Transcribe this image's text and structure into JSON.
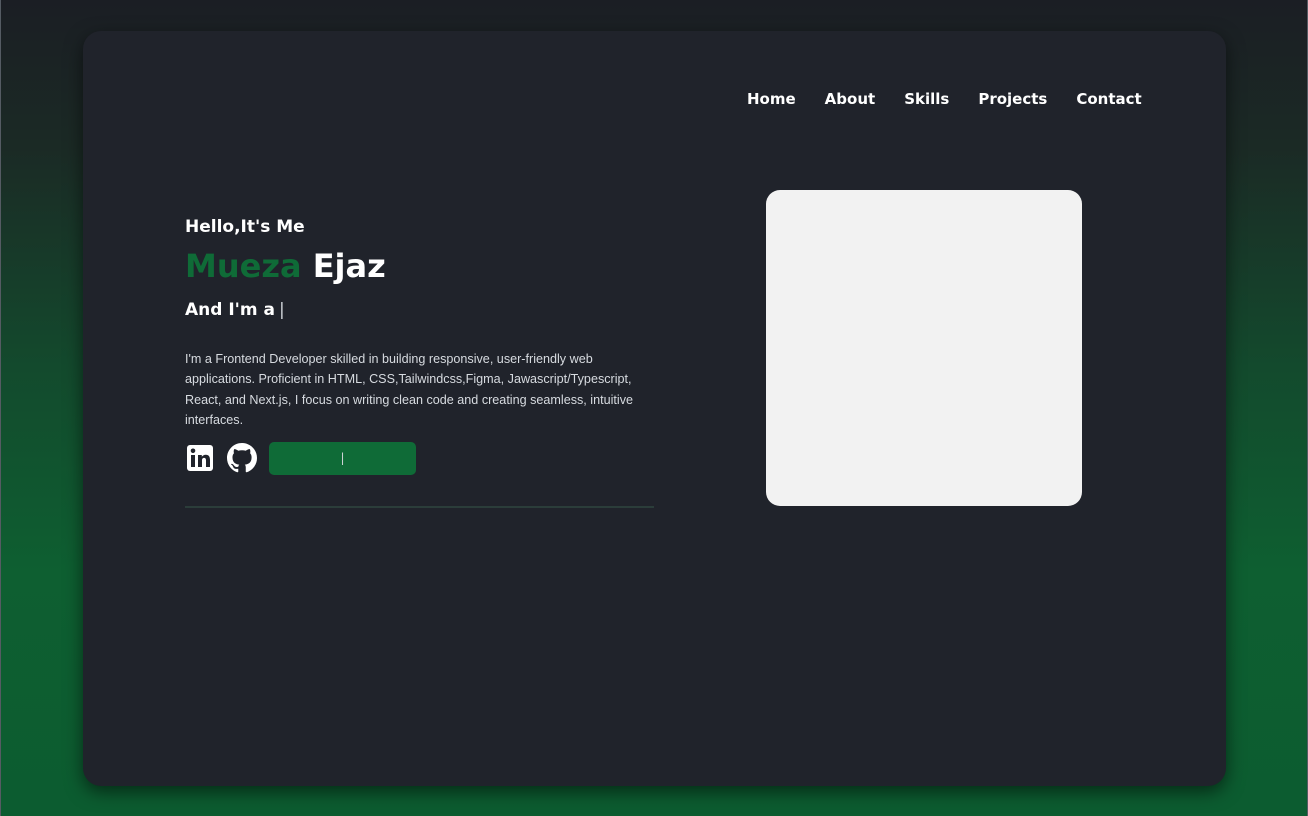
{
  "nav": {
    "items": [
      "Home",
      "About",
      "Skills",
      "Projects",
      "Contact"
    ]
  },
  "hero": {
    "greeting": "Hello,It's Me",
    "first_name": "Mueza",
    "last_name": "Ejaz",
    "role_prefix": "And I'm a",
    "typing_cursor": "|",
    "bio": "I'm a Frontend Developer skilled in building responsive, user-friendly web applications. Proficient in HTML, CSS,Tailwindcss,Figma, Jawascript/Typescript, React, and Next.js, I focus on writing clean code and creating seamless, intuitive interfaces.",
    "cv_button_label": "|"
  },
  "icons": {
    "linkedin": "linkedin-icon",
    "github": "github-icon"
  },
  "colors": {
    "accent_green": "#0f6b37",
    "card_bg": "#20232b",
    "text": "#ffffff",
    "photo_placeholder": "#f2f2f2"
  }
}
